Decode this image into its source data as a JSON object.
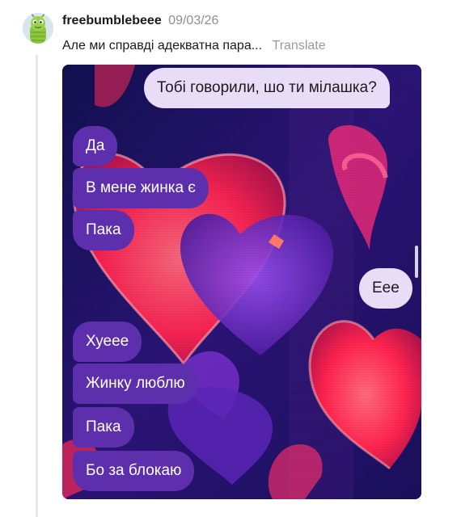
{
  "post": {
    "username": "freebumblebeee",
    "date": "09/03/26",
    "caption": "Але ми справді адекватна пара...",
    "translate_label": "Translate"
  },
  "avatar": {
    "icon": "green-caterpillar-avatar"
  },
  "colors": {
    "outgoing_bubble": "#e8dcf7",
    "incoming_bubble": "#5d2fad",
    "background_deep": "#1c1566",
    "heart_red": "#ff2a55",
    "heart_purple": "#7b2fd4"
  },
  "chat": {
    "messages": [
      {
        "side": "out",
        "text": "Тобі говорили, шо ти мілашка?"
      },
      {
        "side": "in",
        "text": "Да"
      },
      {
        "side": "in",
        "text": "В мене жинка є"
      },
      {
        "side": "in",
        "text": "Пака"
      },
      {
        "side": "out",
        "text": "Еее"
      },
      {
        "side": "in",
        "text": "Хуеее"
      },
      {
        "side": "in",
        "text": "Жинку люблю"
      },
      {
        "side": "in",
        "text": "Пака"
      },
      {
        "side": "in",
        "text": "Бо за блокаю"
      }
    ]
  }
}
